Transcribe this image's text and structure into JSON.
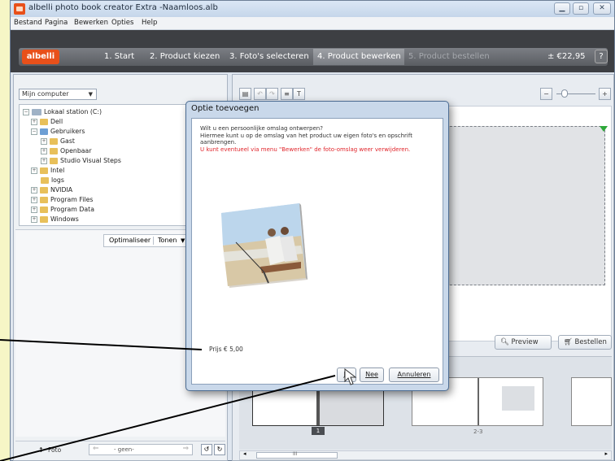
{
  "window": {
    "title": "albelli photo book creator Extra -Naamloos.alb",
    "min_icon": "minimize-icon",
    "max_icon": "maximize-icon",
    "close_icon": "close-icon"
  },
  "menu": [
    "Bestand",
    "Pagina",
    "Bewerken",
    "Opties",
    "Help"
  ],
  "steps": {
    "logo": "albelli",
    "items": [
      "1. Start",
      "2. Product kiezen",
      "3. Foto's selecteren",
      "4. Product bewerken",
      "5. Product bestellen"
    ],
    "price": "± €22,95",
    "help": "?"
  },
  "left": {
    "source_dropdown": "Mijn computer",
    "tree": [
      "Lokaal station (C:)",
      "Dell",
      "Gebruikers",
      "Gast",
      "Openbaar",
      "Studio Visual Steps",
      "Intel",
      "logs",
      "NVIDIA",
      "Program Files",
      "Program Data",
      "Windows"
    ],
    "optimize_label": "Optimaliseer",
    "show_label": "Tonen",
    "photo_label": "Foto",
    "nav_value": "- geen-"
  },
  "main": {
    "preview_label": "Preview",
    "order_label": "Bestellen",
    "thumb_labels": [
      "1",
      "2-3"
    ],
    "scroll_mark": "III"
  },
  "dialog": {
    "title": "Optie toevoegen",
    "line1": "Wilt u een persoonlijke omslag ontwerpen?",
    "line2": "Hiermee kunt u op de omslag van het product uw eigen foto's en opschrift aanbrengen.",
    "warning": "U kunt eventueel via menu \"Bewerken\" de foto-omslag weer verwijderen.",
    "price": "Prijs € 5,00",
    "yes": "Ja",
    "no": "Nee",
    "cancel": "Annuleren"
  },
  "colors": {
    "accent": "#e8501a",
    "stepbar": "#3d3f43",
    "warning": "#e0252b",
    "page_bg": "#f6f6c6"
  }
}
